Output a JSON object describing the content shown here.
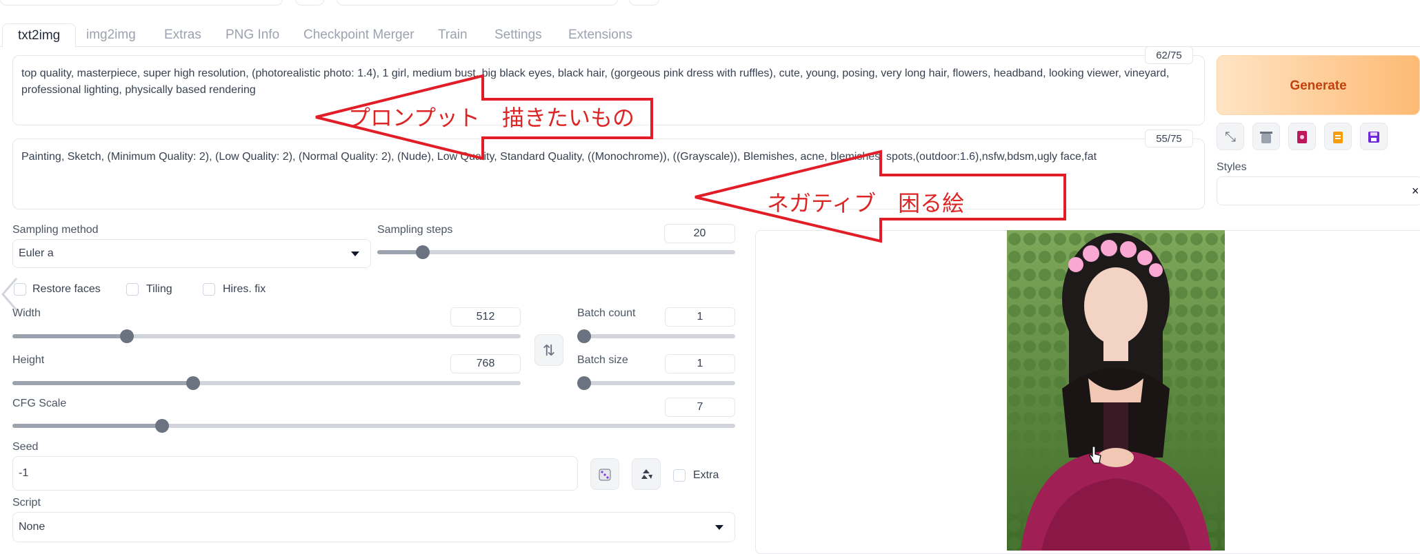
{
  "tabs": [
    "txt2img",
    "img2img",
    "Extras",
    "PNG Info",
    "Checkpoint Merger",
    "Train",
    "Settings",
    "Extensions"
  ],
  "prompt": {
    "text": "top quality, masterpiece, super high resolution, (photorealistic photo: 1.4), 1 girl, medium bust, big black eyes, black hair, (gorgeous pink dress with ruffles), cute, young, posing, very long hair, flowers, headband, looking viewer, vineyard, professional lighting, physically based rendering",
    "token_count": "62/75"
  },
  "negative_prompt": {
    "text": "Painting, Sketch, (Minimum Quality: 2), (Low Quality: 2), (Normal Quality: 2), (Nude), Low Quality, Standard Quality, ((Monochrome)), ((Grayscale)), Blemishes, acne, blemishes, spots,(outdoor:1.6),nsfw,bdsm,ugly face,fat",
    "token_count": "55/75"
  },
  "generate_label": "Generate",
  "styles_label": "Styles",
  "close_glyph": "×",
  "swap_glyph": "⇅",
  "sampling_method": {
    "label": "Sampling method",
    "value": "Euler a"
  },
  "sampling_steps": {
    "label": "Sampling steps",
    "value": "20",
    "min": 1,
    "max": 150,
    "current": 20
  },
  "checkboxes": {
    "restore_faces": "Restore faces",
    "tiling": "Tiling",
    "hires_fix": "Hires. fix",
    "extra": "Extra"
  },
  "width": {
    "label": "Width",
    "value": "512",
    "min": 64,
    "max": 2048,
    "current": 512
  },
  "height": {
    "label": "Height",
    "value": "768",
    "min": 64,
    "max": 2048,
    "current": 768
  },
  "batch_count": {
    "label": "Batch count",
    "value": "1"
  },
  "batch_size": {
    "label": "Batch size",
    "value": "1"
  },
  "cfg_scale": {
    "label": "CFG Scale",
    "value": "7",
    "min": 1,
    "max": 30,
    "current": 7
  },
  "seed": {
    "label": "Seed",
    "value": "-1"
  },
  "script": {
    "label": "Script",
    "value": "None"
  },
  "annotations": {
    "prompt_note": "プロンプット　描きたいもの",
    "negative_note": "ネガティブ　困る絵"
  },
  "colors": {
    "accent": "#fdba74",
    "generate_text": "#c2410c",
    "annotation": "#dc2626"
  }
}
